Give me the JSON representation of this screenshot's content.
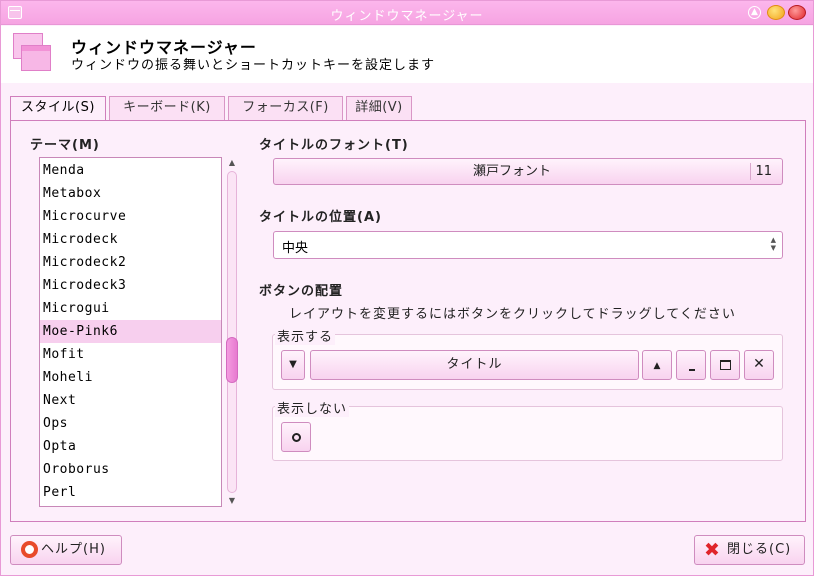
{
  "window": {
    "title": "ウィンドウマネージャー"
  },
  "header": {
    "title": "ウィンドウマネージャー",
    "subtitle": "ウィンドウの振る舞いとショートカットキーを設定します"
  },
  "tabs": [
    {
      "label": "スタイル(S)",
      "active": true
    },
    {
      "label": "キーボード(K)",
      "active": false
    },
    {
      "label": "フォーカス(F)",
      "active": false
    },
    {
      "label": "詳細(V)",
      "active": false
    }
  ],
  "theme": {
    "label": "テーマ(M)",
    "items": [
      "Menda",
      "Metabox",
      "Microcurve",
      "Microdeck",
      "Microdeck2",
      "Microdeck3",
      "Microgui",
      "Moe-Pink6",
      "Mofit",
      "Moheli",
      "Next",
      "Ops",
      "Opta",
      "Oroborus",
      "Perl"
    ],
    "selected": "Moe-Pink6"
  },
  "font": {
    "label": "タイトルのフォント(T)",
    "name": "瀬戸フォント",
    "size": "11"
  },
  "position": {
    "label": "タイトルの位置(A)",
    "value": "中央"
  },
  "buttons": {
    "label": "ボタンの配置",
    "hint": "レイアウトを変更するにはボタンをクリックしてドラッグしてください",
    "shown_label": "表示する",
    "hidden_label": "表示しない",
    "title_button": "タイトル"
  },
  "bottom": {
    "help": "ヘルプ(H)",
    "close": "閉じる(C)"
  },
  "colors": {
    "accent": "#f6a4e2",
    "selection": "#f7cfee",
    "border": "#cf8cbf"
  }
}
